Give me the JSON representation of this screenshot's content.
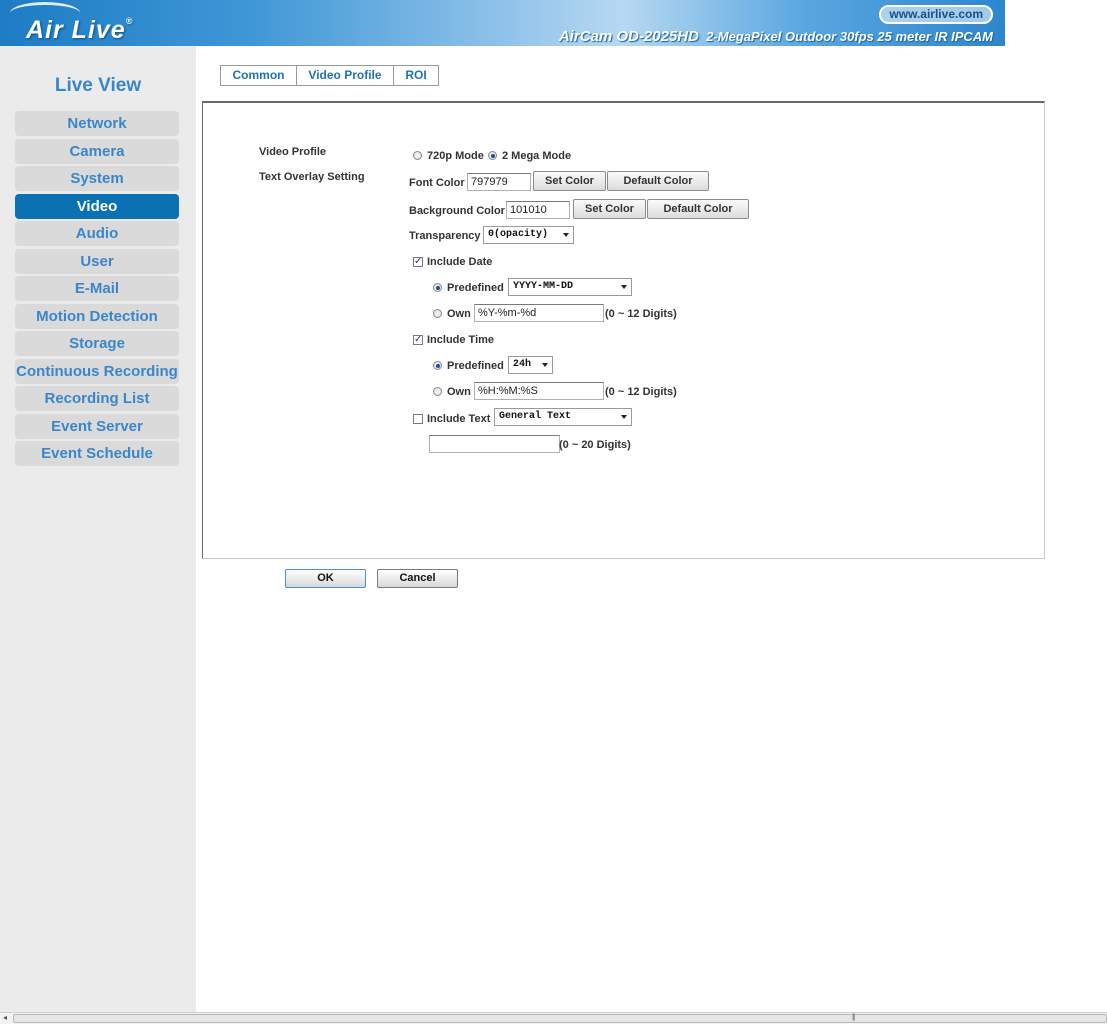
{
  "header": {
    "logo_text": "Air Live",
    "logo_mark": "®",
    "url": "www.airlive.com",
    "model": "AirCam OD-2025HD",
    "tagline": "2-MegaPixel Outdoor 30fps 25 meter IR IPCAM",
    "colors": {
      "banner_start": "#1d7cc4",
      "banner_end": "#2d86cd"
    }
  },
  "sidebar": {
    "title": "Live View",
    "items": [
      {
        "label": "Network",
        "active": false
      },
      {
        "label": "Camera",
        "active": false
      },
      {
        "label": "System",
        "active": false
      },
      {
        "label": "Video",
        "active": true
      },
      {
        "label": "Audio",
        "active": false
      },
      {
        "label": "User",
        "active": false
      },
      {
        "label": "E-Mail",
        "active": false
      },
      {
        "label": "Motion Detection",
        "active": false
      },
      {
        "label": "Storage",
        "active": false
      },
      {
        "label": "Continuous Recording",
        "active": false
      },
      {
        "label": "Recording List",
        "active": false
      },
      {
        "label": "Event Server",
        "active": false
      },
      {
        "label": "Event Schedule",
        "active": false
      }
    ],
    "colors": {
      "active_bg": "#0a71b2",
      "text": "#3a86c9"
    }
  },
  "tabs": [
    {
      "label": "Common",
      "active": true
    },
    {
      "label": "Video Profile",
      "active": false
    },
    {
      "label": "ROI",
      "active": false
    }
  ],
  "form": {
    "video_profile_label": "Video Profile",
    "text_overlay_label": "Text Overlay Setting",
    "mode_720p": "720p Mode",
    "mode_2mega": "2 Mega Mode",
    "selected_mode": "2 Mega Mode",
    "font_color_label": "Font Color",
    "font_color_value": "797979",
    "bg_color_label": "Background Color",
    "bg_color_value": "101010",
    "set_color": "Set Color",
    "default_color": "Default Color",
    "transparency_label": "Transparency",
    "transparency_value": "0(opacity)",
    "include_date_label": "Include Date",
    "include_date_checked": true,
    "predefined_label": "Predefined",
    "date_format_value": "YYYY-MM-DD",
    "own_label": "Own",
    "own_date_value": "%Y-%m-%d",
    "digits_12": "(0 ~ 12 Digits)",
    "include_time_label": "Include Time",
    "include_time_checked": true,
    "time_format_value": "24h",
    "own_time_value": "%H:%M:%S",
    "include_text_label": "Include Text",
    "include_text_checked": false,
    "text_type_value": "General Text",
    "custom_text_value": "",
    "digits_20": "(0 ~ 20 Digits)"
  },
  "actions": {
    "ok": "OK",
    "cancel": "Cancel"
  }
}
